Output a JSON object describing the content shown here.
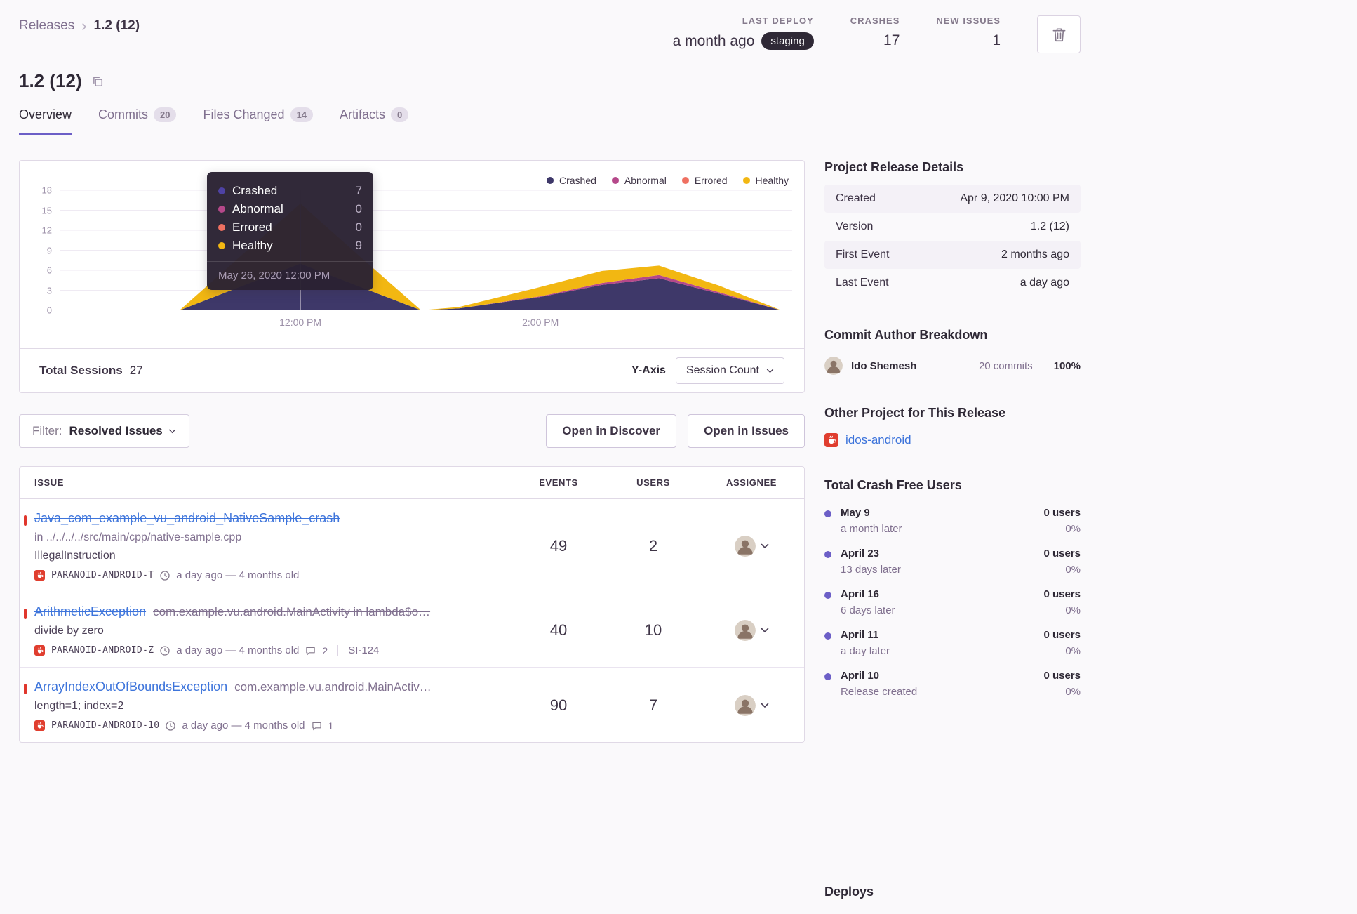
{
  "breadcrumb": {
    "root": "Releases",
    "current": "1.2 (12)"
  },
  "header": {
    "title": "1.2 (12)",
    "stats": [
      {
        "label": "LAST DEPLOY",
        "value": "a month ago",
        "badge": "staging"
      },
      {
        "label": "CRASHES",
        "value": "17"
      },
      {
        "label": "NEW ISSUES",
        "value": "1"
      }
    ]
  },
  "tabs": [
    {
      "label": "Overview"
    },
    {
      "label": "Commits",
      "count": "20"
    },
    {
      "label": "Files Changed",
      "count": "14"
    },
    {
      "label": "Artifacts",
      "count": "0"
    }
  ],
  "chart": {
    "tooltip": {
      "rows": [
        {
          "label": "Crashed",
          "value": "7",
          "color": "#4E42A4"
        },
        {
          "label": "Abnormal",
          "value": "0",
          "color": "#B5488A"
        },
        {
          "label": "Errored",
          "value": "0",
          "color": "#EF7061"
        },
        {
          "label": "Healthy",
          "value": "9",
          "color": "#F2B712"
        }
      ],
      "timestamp": "May 26, 2020 12:00 PM"
    },
    "footer": {
      "total_label": "Total Sessions",
      "total_value": "27",
      "yaxis_label": "Y-Axis",
      "yaxis_value": "Session Count"
    }
  },
  "chart_data": {
    "type": "area",
    "stacked": true,
    "title": "Release sessions over time",
    "ymax": 18,
    "y_ticks": [
      0,
      3,
      6,
      9,
      12,
      15,
      18
    ],
    "x_ticks": [
      {
        "label": "12:00 PM",
        "pos": 0.328
      },
      {
        "label": "2:00 PM",
        "pos": 0.656
      }
    ],
    "hover_x": 0.328,
    "x": [
      0.163,
      0.245,
      0.328,
      0.41,
      0.493,
      0.545,
      0.656,
      0.74,
      0.818,
      0.9,
      0.985
    ],
    "series": [
      {
        "name": "Crashed",
        "color": "#3E3869",
        "values": [
          0,
          3.5,
          7,
          3.5,
          0,
          0.3,
          2,
          3.8,
          4.8,
          2.5,
          0
        ]
      },
      {
        "name": "Abnormal",
        "color": "#B5488A",
        "values": [
          0,
          0,
          0,
          0,
          0,
          0,
          0.1,
          0.3,
          0.5,
          0.2,
          0
        ]
      },
      {
        "name": "Errored",
        "color": "#EF7061",
        "values": [
          0,
          0,
          0,
          0,
          0,
          0,
          0,
          0,
          0,
          0,
          0
        ]
      },
      {
        "name": "Healthy",
        "color": "#F2B712",
        "values": [
          0,
          4.5,
          9,
          4.5,
          0,
          0.2,
          1.4,
          1.8,
          1.4,
          1,
          0
        ]
      }
    ],
    "legend_position": "top-right"
  },
  "filter": {
    "label": "Filter:",
    "value": "Resolved Issues"
  },
  "actions": {
    "discover": "Open in Discover",
    "issues": "Open in Issues"
  },
  "issues": {
    "columns": [
      "ISSUE",
      "EVENTS",
      "USERS",
      "ASSIGNEE"
    ],
    "rows": [
      {
        "title": "Java_com_example_vu_android_NativeSample_crash",
        "subtitle": "in ../../../../src/main/cpp/native-sample.cpp",
        "message": "IllegalInstruction",
        "project": "PARANOID-ANDROID-T",
        "age": "a day ago — 4 months old",
        "events": "49",
        "users": "2"
      },
      {
        "title": "ArithmeticException",
        "title_suffix": "com.example.vu.android.MainActivity in lambda$o…",
        "message": "divide by zero",
        "project": "PARANOID-ANDROID-Z",
        "age": "a day ago — 4 months old",
        "comments": "2",
        "annotation": "SI-124",
        "events": "40",
        "users": "10"
      },
      {
        "title": "ArrayIndexOutOfBoundsException",
        "title_suffix": "com.example.vu.android.MainActiv…",
        "message": "length=1; index=2",
        "project": "PARANOID-ANDROID-10",
        "age": "a day ago — 4 months old",
        "comments": "1",
        "events": "90",
        "users": "7"
      }
    ]
  },
  "sidebar": {
    "release_details": {
      "title": "Project Release Details",
      "rows": [
        {
          "label": "Created",
          "value": "Apr 9, 2020 10:00 PM"
        },
        {
          "label": "Version",
          "value": "1.2 (12)"
        },
        {
          "label": "First Event",
          "value": "2 months ago"
        },
        {
          "label": "Last Event",
          "value": "a day ago"
        }
      ]
    },
    "commit_authors": {
      "title": "Commit Author Breakdown",
      "author": {
        "name": "Ido Shemesh",
        "commits": "20 commits",
        "percent": "100%"
      }
    },
    "other_project": {
      "title": "Other Project for This Release",
      "link": "idos-android"
    },
    "crash_free": {
      "title": "Total Crash Free Users",
      "rows": [
        {
          "date": "May 9",
          "sub": "a month later",
          "users": "0 users",
          "percent": "0%"
        },
        {
          "date": "April 23",
          "sub": "13 days later",
          "users": "0 users",
          "percent": "0%"
        },
        {
          "date": "April 16",
          "sub": "6 days later",
          "users": "0 users",
          "percent": "0%"
        },
        {
          "date": "April 11",
          "sub": "a day later",
          "users": "0 users",
          "percent": "0%"
        },
        {
          "date": "April 10",
          "sub": "Release created",
          "users": "0 users",
          "percent": "0%"
        }
      ]
    },
    "deploys_title": "Deploys"
  }
}
